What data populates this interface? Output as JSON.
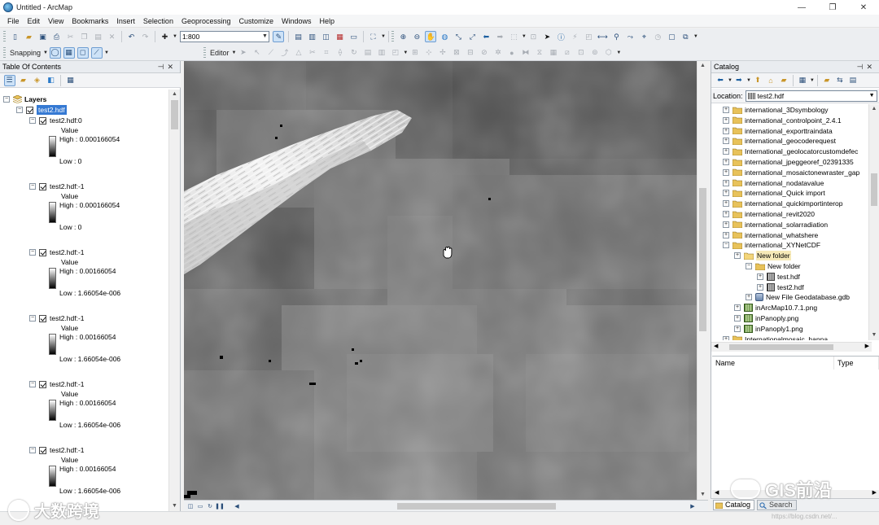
{
  "window": {
    "title": "Untitled - ArcMap",
    "controls": {
      "minimize": "—",
      "maximize": "❐",
      "close": "✕"
    }
  },
  "menu": [
    "File",
    "Edit",
    "View",
    "Bookmarks",
    "Insert",
    "Selection",
    "Geoprocessing",
    "Customize",
    "Windows",
    "Help"
  ],
  "toolbar": {
    "scale_value": "1:800",
    "snapping_label": "Snapping",
    "editor_label": "Editor"
  },
  "toc": {
    "title": "Table Of Contents",
    "root_label": "Layers",
    "group_label": "test2.hdf",
    "layers": [
      {
        "name": "test2.hdf:0",
        "field": "Value",
        "high": "High : 0.000166054",
        "low": "Low : 0"
      },
      {
        "name": "test2.hdf:-1",
        "field": "Value",
        "high": "High : 0.000166054",
        "low": "Low : 0"
      },
      {
        "name": "test2.hdf:-1",
        "field": "Value",
        "high": "High : 0.00166054",
        "low": "Low : 1.66054e-006"
      },
      {
        "name": "test2.hdf:-1",
        "field": "Value",
        "high": "High : 0.00166054",
        "low": "Low : 1.66054e-006"
      },
      {
        "name": "test2.hdf:-1",
        "field": "Value",
        "high": "High : 0.00166054",
        "low": "Low : 1.66054e-006"
      },
      {
        "name": "test2.hdf:-1",
        "field": "Value",
        "high": "High : 0.00166054",
        "low": "Low : 1.66054e-006"
      }
    ]
  },
  "catalog": {
    "title": "Catalog",
    "location_label": "Location:",
    "location_value": "test2.hdf",
    "tree": [
      {
        "label": "international_3Dsymbology",
        "type": "folder",
        "depth": 0
      },
      {
        "label": "international_controlpoint_2.4.1",
        "type": "folder",
        "depth": 0
      },
      {
        "label": "international_exporttraindata",
        "type": "folder",
        "depth": 0
      },
      {
        "label": "international_geocoderequest",
        "type": "folder",
        "depth": 0
      },
      {
        "label": "International_geolocatorcustomdefec",
        "type": "folder",
        "depth": 0
      },
      {
        "label": "international_jpeggeoref_02391335",
        "type": "folder",
        "depth": 0
      },
      {
        "label": "international_mosaictonewraster_gap",
        "type": "folder",
        "depth": 0
      },
      {
        "label": "international_nodatavalue",
        "type": "folder",
        "depth": 0
      },
      {
        "label": "international_Quick import",
        "type": "folder",
        "depth": 0
      },
      {
        "label": "international_quickimportinterop",
        "type": "folder",
        "depth": 0
      },
      {
        "label": "international_revit2020",
        "type": "folder",
        "depth": 0
      },
      {
        "label": "international_solarradiation",
        "type": "folder",
        "depth": 0
      },
      {
        "label": "international_whatshere",
        "type": "folder",
        "depth": 0
      },
      {
        "label": "international_XYNetCDF",
        "type": "folder",
        "depth": 0,
        "expanded": true
      },
      {
        "label": "New folder",
        "type": "folder-open",
        "depth": 1,
        "highlight": true
      },
      {
        "label": "New folder",
        "type": "folder",
        "depth": 2,
        "expanded": true
      },
      {
        "label": "test.hdf",
        "type": "raster",
        "depth": 3
      },
      {
        "label": "test2.hdf",
        "type": "raster",
        "depth": 3
      },
      {
        "label": "New File Geodatabase.gdb",
        "type": "gdb",
        "depth": 2
      },
      {
        "label": "inArcMap10.7.1.png",
        "type": "image",
        "depth": 1
      },
      {
        "label": "inPanoply.png",
        "type": "image",
        "depth": 1
      },
      {
        "label": "inPanoply1.png",
        "type": "image",
        "depth": 1
      },
      {
        "label": "Internationalmosaic_hanna",
        "type": "folder",
        "depth": 0
      }
    ],
    "columns": [
      "Name",
      "Type"
    ],
    "tabs": [
      "Catalog",
      "Search"
    ]
  },
  "watermarks": {
    "left": "大数跨境",
    "right": "GIS前沿",
    "url": "https://blog.csdn.net/..."
  },
  "colors": {
    "selection": "#3579d3",
    "map_background": "#5a5a5a",
    "folder": "#e8c25a"
  }
}
